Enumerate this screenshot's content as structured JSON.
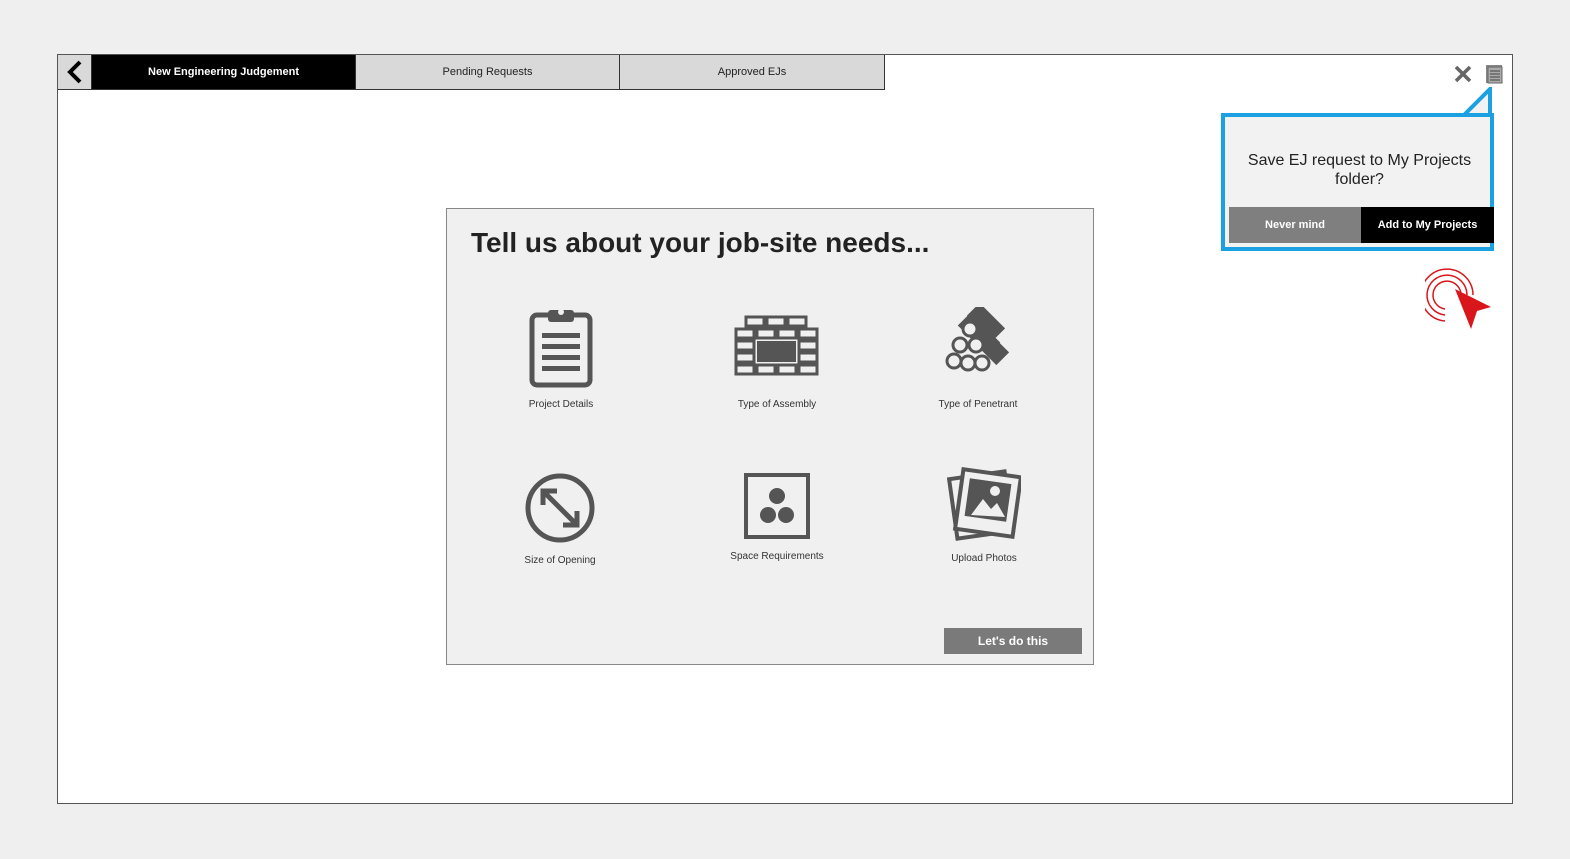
{
  "tabs": {
    "back_icon": "chevron-left-icon",
    "items": [
      {
        "label": "New Engineering Judgement",
        "active": true
      },
      {
        "label": "Pending Requests",
        "active": false
      },
      {
        "label": "Approved EJs",
        "active": false
      }
    ]
  },
  "toolbar": {
    "close_icon": "close-icon",
    "document_icon": "document-icon"
  },
  "card": {
    "title": "Tell us about your job-site needs...",
    "tiles": [
      {
        "label": "Project Details",
        "icon": "clipboard-icon"
      },
      {
        "label": "Type of Assembly",
        "icon": "brick-wall-icon"
      },
      {
        "label": "Type of Penetrant",
        "icon": "pipes-icon"
      },
      {
        "label": "Size of Opening",
        "icon": "diagonal-resize-icon"
      },
      {
        "label": "Space Requirements",
        "icon": "three-circles-icon"
      },
      {
        "label": "Upload Photos",
        "icon": "photos-icon"
      }
    ],
    "cta_label": "Let's do this"
  },
  "popover": {
    "message": "Save EJ request to My Projects folder?",
    "cancel_label": "Never mind",
    "confirm_label": "Add to My Projects"
  },
  "colors": {
    "accent_blue": "#1ba1e2",
    "cursor_red": "#d9161c",
    "active_tab": "#000000",
    "inactive_tab": "#d9d9d9"
  }
}
